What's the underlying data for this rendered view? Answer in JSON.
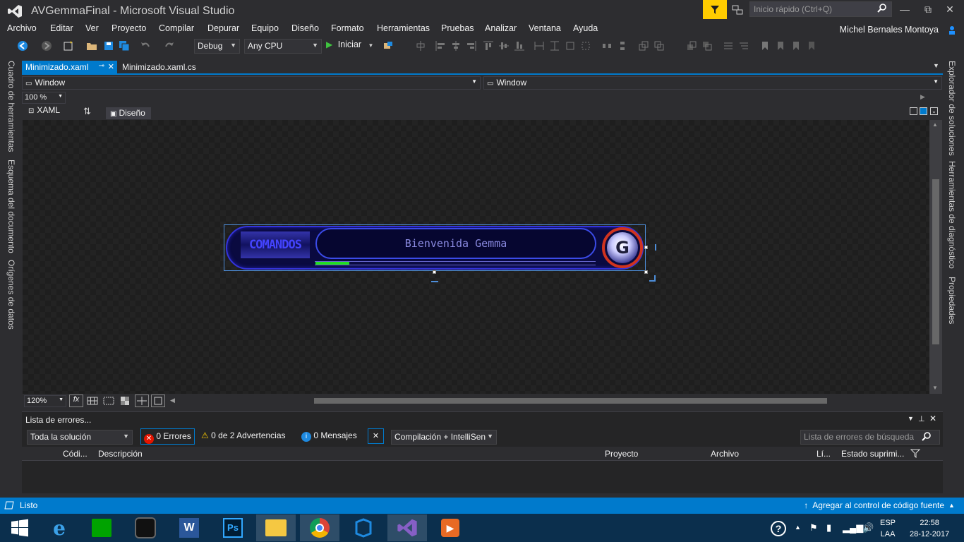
{
  "window": {
    "title": "AVGemmaFinal - Microsoft Visual Studio",
    "quick_launch_placeholder": "Inicio rápido (Ctrl+Q)",
    "minimize": "—",
    "maximize": "⧉",
    "close": "✕"
  },
  "menu": {
    "items": [
      "Archivo",
      "Editar",
      "Ver",
      "Proyecto",
      "Compilar",
      "Depurar",
      "Equipo",
      "Diseño",
      "Formato",
      "Herramientas",
      "Pruebas",
      "Analizar",
      "Ventana",
      "Ayuda"
    ],
    "user": "Michel Bernales Montoya"
  },
  "toolbar": {
    "config": "Debug",
    "platform": "Any CPU",
    "start": "Iniciar"
  },
  "left_panel": {
    "tabs": [
      "Cuadro de herramientas",
      "Esquema del documento",
      "Orígenes de datos"
    ]
  },
  "right_panel": {
    "tabs": [
      "Explorador de soluciones",
      "Herramientas de diagnóstico",
      "Propiedades"
    ]
  },
  "doc_tabs": {
    "active": "Minimizado.xaml",
    "inactive": "Minimizado.xaml.cs"
  },
  "nav": {
    "left": "Window",
    "right": "Window",
    "zoom": "100 %"
  },
  "split": {
    "xaml": "XAML",
    "design": "Diseño"
  },
  "designer": {
    "zoom": "120%",
    "fx": "fx"
  },
  "widget": {
    "commands_label": "COMANDOS",
    "welcome_text": "Bienvenida Gemma",
    "avatar_letter": "G",
    "progress": 0.12
  },
  "error_list": {
    "title": "Lista de errores...",
    "scope": "Toda la solución",
    "errors": "0 Errores",
    "warnings": "0 de 2 Advertencias",
    "messages": "0 Mensajes",
    "build_filter": "Compilación + IntelliSen",
    "search_placeholder": "Lista de errores de búsqueda",
    "columns": [
      "Códi...",
      "Descripción",
      "Proyecto",
      "Archivo",
      "Lí...",
      "Estado suprimi..."
    ]
  },
  "status": {
    "left": "Listo",
    "right": "Agregar al control de código fuente"
  },
  "tray": {
    "lang1": "ESP",
    "lang2": "LAA",
    "time": "22:58",
    "date": "28-12-2017"
  },
  "colors": {
    "accent": "#007acc",
    "widget_border": "#3333dd",
    "progress": "#22dd22",
    "avatar_ring": "#d0331f"
  }
}
